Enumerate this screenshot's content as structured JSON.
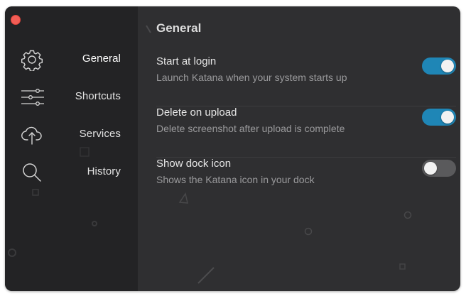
{
  "window": {
    "close_button": "close"
  },
  "sidebar": {
    "items": [
      {
        "label": "General",
        "icon": "gear-icon",
        "active": true
      },
      {
        "label": "Shortcuts",
        "icon": "sliders-icon",
        "active": false
      },
      {
        "label": "Services",
        "icon": "cloud-upload-icon",
        "active": false
      },
      {
        "label": "History",
        "icon": "search-icon",
        "active": false
      }
    ]
  },
  "main": {
    "title": "General",
    "settings": [
      {
        "title": "Start at login",
        "description": "Launch Katana when your system starts up",
        "enabled": true
      },
      {
        "title": "Delete on upload",
        "description": "Delete screenshot after upload is complete",
        "enabled": true
      },
      {
        "title": "Show dock icon",
        "description": "Shows the Katana icon in your dock",
        "enabled": false
      }
    ]
  },
  "colors": {
    "sidebar_bg": "#232325",
    "content_bg": "#2f2f31",
    "toggle_on": "#1f86b6",
    "toggle_off": "#5a5a5c",
    "close_button": "#f35e56"
  }
}
